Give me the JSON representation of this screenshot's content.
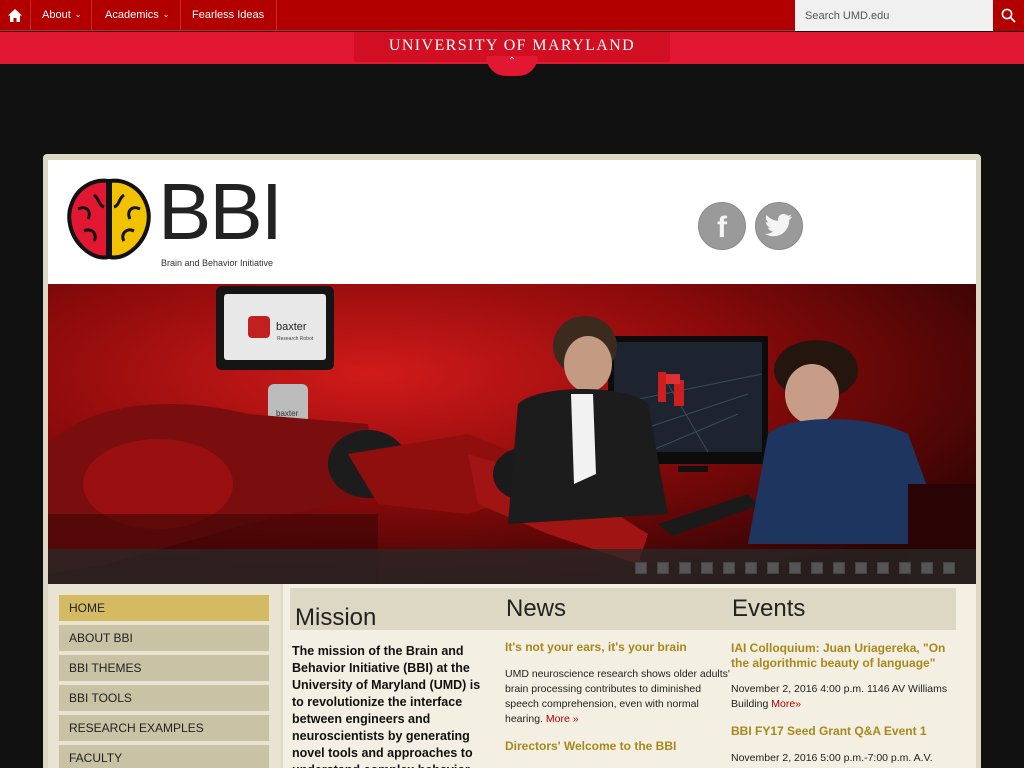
{
  "topbar": {
    "nav": [
      {
        "label": "About",
        "chevron": true
      },
      {
        "label": "Academics",
        "chevron": true
      },
      {
        "label": "Fearless Ideas",
        "chevron": false
      }
    ],
    "search_placeholder": "Search UMD.edu"
  },
  "brand": {
    "name": "UNIVERSITY OF MARYLAND"
  },
  "header": {
    "logo_title": "BBI",
    "logo_subtitle": "Brain and Behavior Initiative",
    "social": [
      "facebook-icon",
      "twitter-icon"
    ]
  },
  "hero": {
    "robot_screen_text": "baxter",
    "robot_screen_subtext": "Research Robot",
    "robot_label": "baxter",
    "slide_count": 15
  },
  "sidebar": {
    "items": [
      {
        "label": "HOME",
        "active": true
      },
      {
        "label": "ABOUT BBI",
        "active": false
      },
      {
        "label": "BBI THEMES",
        "active": false
      },
      {
        "label": "BBI TOOLS",
        "active": false
      },
      {
        "label": "RESEARCH EXAMPLES",
        "active": false
      },
      {
        "label": "FACULTY",
        "active": false
      }
    ]
  },
  "mission": {
    "heading": "Mission",
    "text": "The mission of the Brain and Behavior Initiative (BBI) at the University of Maryland (UMD) is to revolutionize the interface between engineers and neuroscientists by generating novel tools and approaches to understand complex behavior"
  },
  "news": {
    "heading": "News",
    "items": [
      {
        "title": "It's not your ears, it's your brain",
        "body": "UMD neuroscience research shows older adults' brain processing contributes to diminished speech comprehension, even with normal hearing.",
        "more": "More »"
      },
      {
        "title": "Directors' Welcome to the BBI"
      }
    ]
  },
  "events": {
    "heading": "Events",
    "items": [
      {
        "title": "IAI Colloquium: Juan Uriagereka, \"On the algorithmic beauty of language\"",
        "info": "November 2, 2016 4:00 p.m. 1146 AV Williams Building",
        "more": "More»"
      },
      {
        "title": "BBI FY17 Seed Grant Q&A Event 1",
        "info": "November 2, 2016 5:00 p.m.-7:00 p.m. A.V."
      }
    ]
  },
  "colors": {
    "umd_red": "#e21833",
    "topbar_red": "#b20000",
    "gold_link": "#a8881b",
    "sidebar_active": "#d4bb63",
    "sidebar_item": "#c9c2a4"
  }
}
